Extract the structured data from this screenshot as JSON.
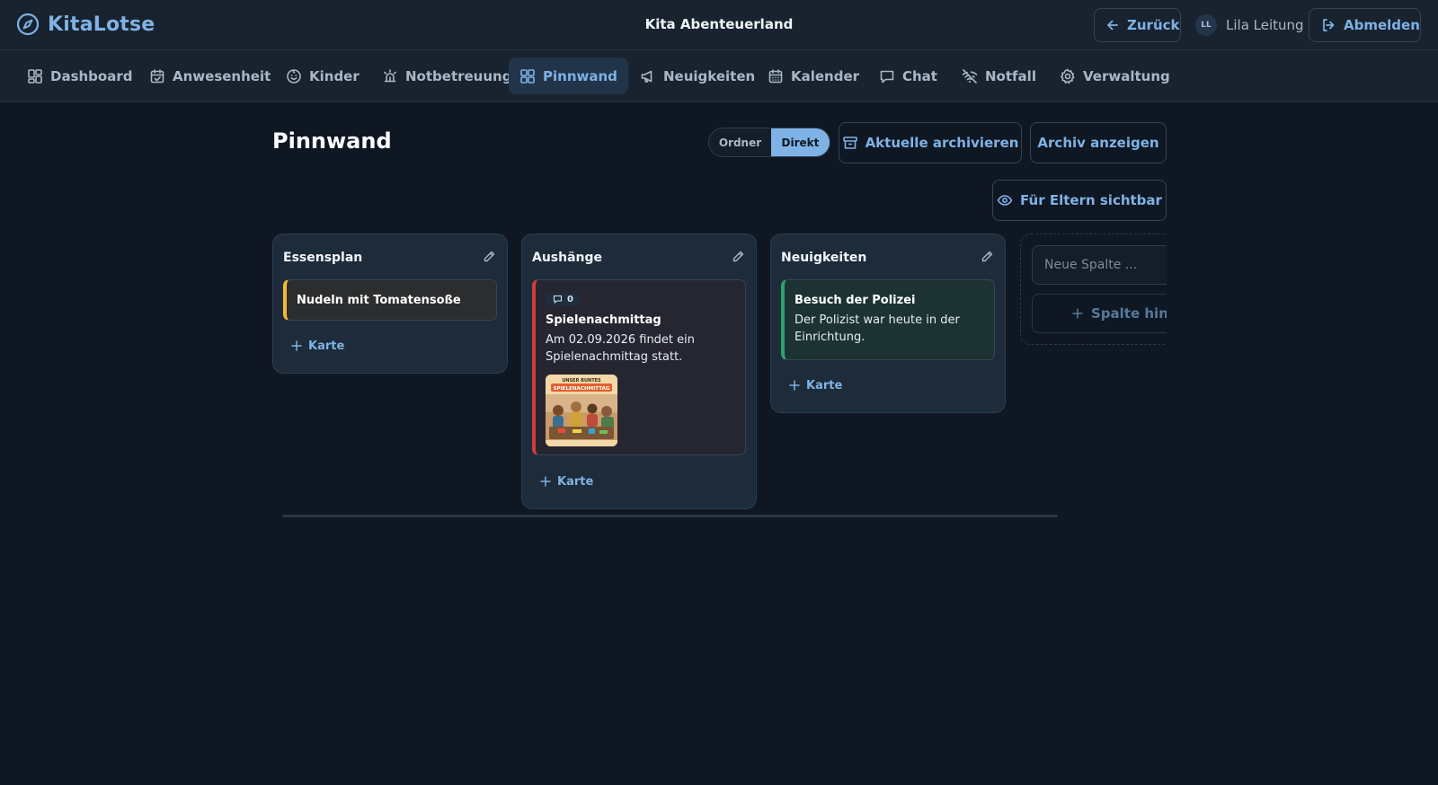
{
  "header": {
    "app_name": "KitaLotse",
    "org_name": "Kita Abenteuerland",
    "back_label": "Zurück",
    "user_initials": "LL",
    "user_name": "Lila Leitung",
    "logout_label": "Abmelden"
  },
  "nav": {
    "items": [
      {
        "label": "Dashboard",
        "icon": "grid-icon"
      },
      {
        "label": "Anwesenheit",
        "icon": "calendar-check-icon"
      },
      {
        "label": "Kinder",
        "icon": "smile-icon"
      },
      {
        "label": "Notbetreuung",
        "icon": "siren-icon"
      },
      {
        "label": "Pinnwand",
        "icon": "grid-icon",
        "active": true
      },
      {
        "label": "Neuigkeiten",
        "icon": "megaphone-icon"
      },
      {
        "label": "Kalender",
        "icon": "calendar-icon"
      },
      {
        "label": "Chat",
        "icon": "message-icon"
      },
      {
        "label": "Notfall",
        "icon": "wifi-off-icon"
      },
      {
        "label": "Verwaltung",
        "icon": "gear-icon"
      }
    ]
  },
  "page": {
    "title": "Pinnwand",
    "view_toggle": {
      "options": [
        "Ordner",
        "Direkt"
      ],
      "selected": "Direkt"
    },
    "archive_current_label": "Aktuelle archivieren",
    "show_archive_label": "Archiv anzeigen",
    "visible_for_parents_label": "Für Eltern sichtbar"
  },
  "board": {
    "columns": [
      {
        "title": "Essensplan",
        "cards": [
          {
            "title": "Nudeln mit Tomatensoße",
            "accent": "#f5b82e"
          }
        ],
        "add_card_label": "Karte"
      },
      {
        "title": "Aushänge",
        "cards": [
          {
            "comment_count": "0",
            "title": "Spielenachmittag",
            "text": "Am 02.09.2026 findet ein Spielenachmittag statt.",
            "accent": "#d23b3b",
            "image": {
              "poster_line1": "UNSER BUNTES",
              "poster_line2": "SPIELENACHMITTAG"
            }
          }
        ],
        "add_card_label": "Karte"
      },
      {
        "title": "Neuigkeiten",
        "cards": [
          {
            "title": "Besuch der Polizei",
            "text": "Der Polizist war heute in der Einrichtung.",
            "accent": "#2fa36b"
          }
        ],
        "add_card_label": "Karte"
      }
    ],
    "new_column": {
      "placeholder": "Neue Spalte ...",
      "button_label": "Spalte hinzufügen"
    }
  },
  "colors": {
    "background": "#0f1722",
    "surface": "#18232f",
    "accent": "#7fb2e5"
  }
}
